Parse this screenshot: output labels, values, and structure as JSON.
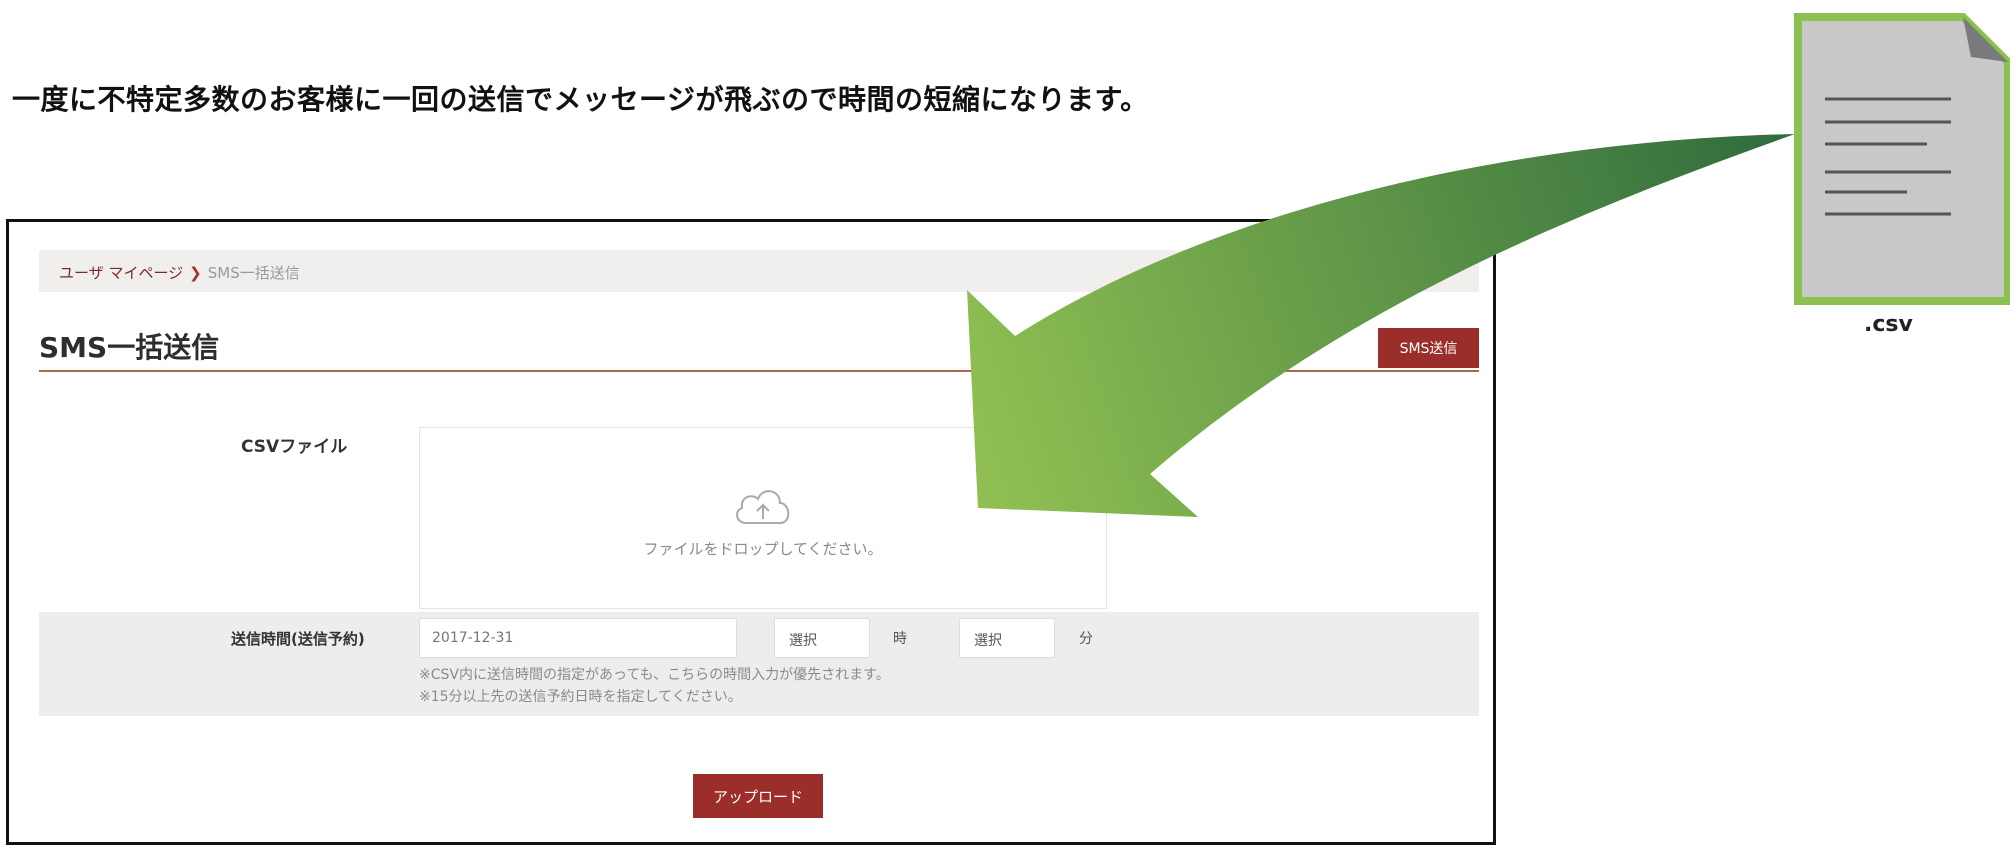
{
  "headline": "一度に不特定多数のお客様に一回の送信でメッセージが飛ぶので時間の短縮になります。",
  "breadcrumb": {
    "home": "ユーザ マイページ",
    "separator": "❯",
    "current": "SMS一括送信"
  },
  "page": {
    "title": "SMS一括送信",
    "sms_send_button": "SMS送信"
  },
  "form": {
    "csv_label": "CSVファイル",
    "drop_text": "ファイルをドロップしてください。",
    "time_label": "送信時間(送信予約)",
    "date_placeholder": "2017-12-31",
    "hour_select": "選択",
    "hour_unit": "時",
    "minute_select": "選択",
    "minute_unit": "分",
    "note1": "※CSV内に送信時間の指定があっても、こちらの時間入力が優先されます。",
    "note2": "※15分以上先の送信予約日時を指定してください。",
    "upload_button": "アップロード"
  },
  "file": {
    "label": ".csv"
  },
  "colors": {
    "brand_red": "#9b2e2b",
    "arrow_light": "#8fbf52",
    "arrow_dark": "#2e6b3d",
    "doc_border": "#8cc152"
  }
}
